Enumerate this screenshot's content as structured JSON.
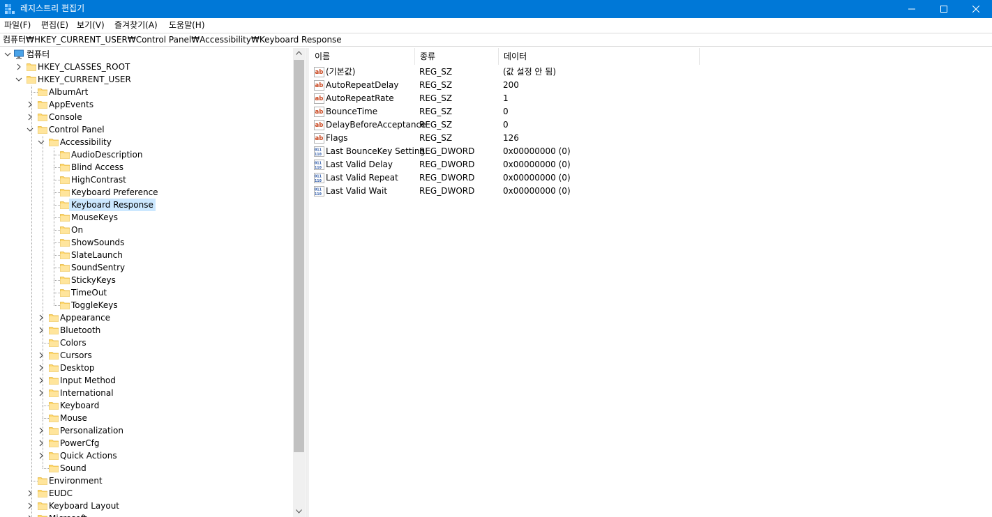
{
  "window": {
    "title": "레지스트리 편집기"
  },
  "menu": [
    "파일(F)",
    "편집(E)",
    "보기(V)",
    "즐겨찾기(A)",
    "도움말(H)"
  ],
  "address": "컴퓨터₩HKEY_CURRENT_USER₩Control Panel₩Accessibility₩Keyboard Response",
  "tree": [
    {
      "label": "컴퓨터",
      "level": 0,
      "expander": "expanded",
      "icon": "computer-icon"
    },
    {
      "label": "HKEY_CLASSES_ROOT",
      "level": 1,
      "expander": "collapsed",
      "icon": "folder-icon"
    },
    {
      "label": "HKEY_CURRENT_USER",
      "level": 1,
      "expander": "expanded",
      "icon": "folder-icon"
    },
    {
      "label": "AlbumArt",
      "level": 2,
      "expander": "none",
      "icon": "folder-icon"
    },
    {
      "label": "AppEvents",
      "level": 2,
      "expander": "collapsed",
      "icon": "folder-icon"
    },
    {
      "label": "Console",
      "level": 2,
      "expander": "collapsed",
      "icon": "folder-icon"
    },
    {
      "label": "Control Panel",
      "level": 2,
      "expander": "expanded",
      "icon": "folder-icon"
    },
    {
      "label": "Accessibility",
      "level": 3,
      "expander": "expanded",
      "icon": "folder-icon"
    },
    {
      "label": "AudioDescription",
      "level": 4,
      "expander": "none",
      "icon": "folder-icon"
    },
    {
      "label": "Blind Access",
      "level": 4,
      "expander": "none",
      "icon": "folder-icon"
    },
    {
      "label": "HighContrast",
      "level": 4,
      "expander": "none",
      "icon": "folder-icon"
    },
    {
      "label": "Keyboard Preference",
      "level": 4,
      "expander": "none",
      "icon": "folder-icon"
    },
    {
      "label": "Keyboard Response",
      "level": 4,
      "expander": "none",
      "icon": "folder-icon",
      "selected": true
    },
    {
      "label": "MouseKeys",
      "level": 4,
      "expander": "none",
      "icon": "folder-icon"
    },
    {
      "label": "On",
      "level": 4,
      "expander": "none",
      "icon": "folder-icon"
    },
    {
      "label": "ShowSounds",
      "level": 4,
      "expander": "none",
      "icon": "folder-icon"
    },
    {
      "label": "SlateLaunch",
      "level": 4,
      "expander": "none",
      "icon": "folder-icon"
    },
    {
      "label": "SoundSentry",
      "level": 4,
      "expander": "none",
      "icon": "folder-icon"
    },
    {
      "label": "StickyKeys",
      "level": 4,
      "expander": "none",
      "icon": "folder-icon"
    },
    {
      "label": "TimeOut",
      "level": 4,
      "expander": "none",
      "icon": "folder-icon"
    },
    {
      "label": "ToggleKeys",
      "level": 4,
      "expander": "none",
      "icon": "folder-icon"
    },
    {
      "label": "Appearance",
      "level": 3,
      "expander": "collapsed",
      "icon": "folder-icon"
    },
    {
      "label": "Bluetooth",
      "level": 3,
      "expander": "collapsed",
      "icon": "folder-icon"
    },
    {
      "label": "Colors",
      "level": 3,
      "expander": "none",
      "icon": "folder-icon"
    },
    {
      "label": "Cursors",
      "level": 3,
      "expander": "collapsed",
      "icon": "folder-icon"
    },
    {
      "label": "Desktop",
      "level": 3,
      "expander": "collapsed",
      "icon": "folder-icon"
    },
    {
      "label": "Input Method",
      "level": 3,
      "expander": "collapsed",
      "icon": "folder-icon"
    },
    {
      "label": "International",
      "level": 3,
      "expander": "collapsed",
      "icon": "folder-icon"
    },
    {
      "label": "Keyboard",
      "level": 3,
      "expander": "none",
      "icon": "folder-icon"
    },
    {
      "label": "Mouse",
      "level": 3,
      "expander": "none",
      "icon": "folder-icon"
    },
    {
      "label": "Personalization",
      "level": 3,
      "expander": "collapsed",
      "icon": "folder-icon"
    },
    {
      "label": "PowerCfg",
      "level": 3,
      "expander": "collapsed",
      "icon": "folder-icon"
    },
    {
      "label": "Quick Actions",
      "level": 3,
      "expander": "collapsed",
      "icon": "folder-icon"
    },
    {
      "label": "Sound",
      "level": 3,
      "expander": "none",
      "icon": "folder-icon"
    },
    {
      "label": "Environment",
      "level": 2,
      "expander": "none",
      "icon": "folder-icon"
    },
    {
      "label": "EUDC",
      "level": 2,
      "expander": "collapsed",
      "icon": "folder-icon"
    },
    {
      "label": "Keyboard Layout",
      "level": 2,
      "expander": "collapsed",
      "icon": "folder-icon"
    },
    {
      "label": "Microsoft",
      "level": 2,
      "expander": "collapsed",
      "icon": "folder-icon"
    }
  ],
  "list": {
    "columns": [
      "이름",
      "종류",
      "데이터"
    ],
    "rows": [
      {
        "name": "(기본값)",
        "type": "REG_SZ",
        "data": "(값 설정 안 됨)",
        "icon": "string-value-icon"
      },
      {
        "name": "AutoRepeatDelay",
        "type": "REG_SZ",
        "data": "200",
        "icon": "string-value-icon"
      },
      {
        "name": "AutoRepeatRate",
        "type": "REG_SZ",
        "data": "1",
        "icon": "string-value-icon"
      },
      {
        "name": "BounceTime",
        "type": "REG_SZ",
        "data": "0",
        "icon": "string-value-icon"
      },
      {
        "name": "DelayBeforeAcceptance",
        "type": "REG_SZ",
        "data": "0",
        "icon": "string-value-icon"
      },
      {
        "name": "Flags",
        "type": "REG_SZ",
        "data": "126",
        "icon": "string-value-icon"
      },
      {
        "name": "Last BounceKey Setting",
        "type": "REG_DWORD",
        "data": "0x00000000 (0)",
        "icon": "binary-value-icon"
      },
      {
        "name": "Last Valid Delay",
        "type": "REG_DWORD",
        "data": "0x00000000 (0)",
        "icon": "binary-value-icon"
      },
      {
        "name": "Last Valid Repeat",
        "type": "REG_DWORD",
        "data": "0x00000000 (0)",
        "icon": "binary-value-icon"
      },
      {
        "name": "Last Valid Wait",
        "type": "REG_DWORD",
        "data": "0x00000000 (0)",
        "icon": "binary-value-icon"
      }
    ]
  },
  "colors": {
    "titlebar": "#0078d7",
    "selection": "#cce8ff",
    "folder": "#ffd86e",
    "string_icon": "#c8431b",
    "dword_icon": "#1f4fa3"
  }
}
